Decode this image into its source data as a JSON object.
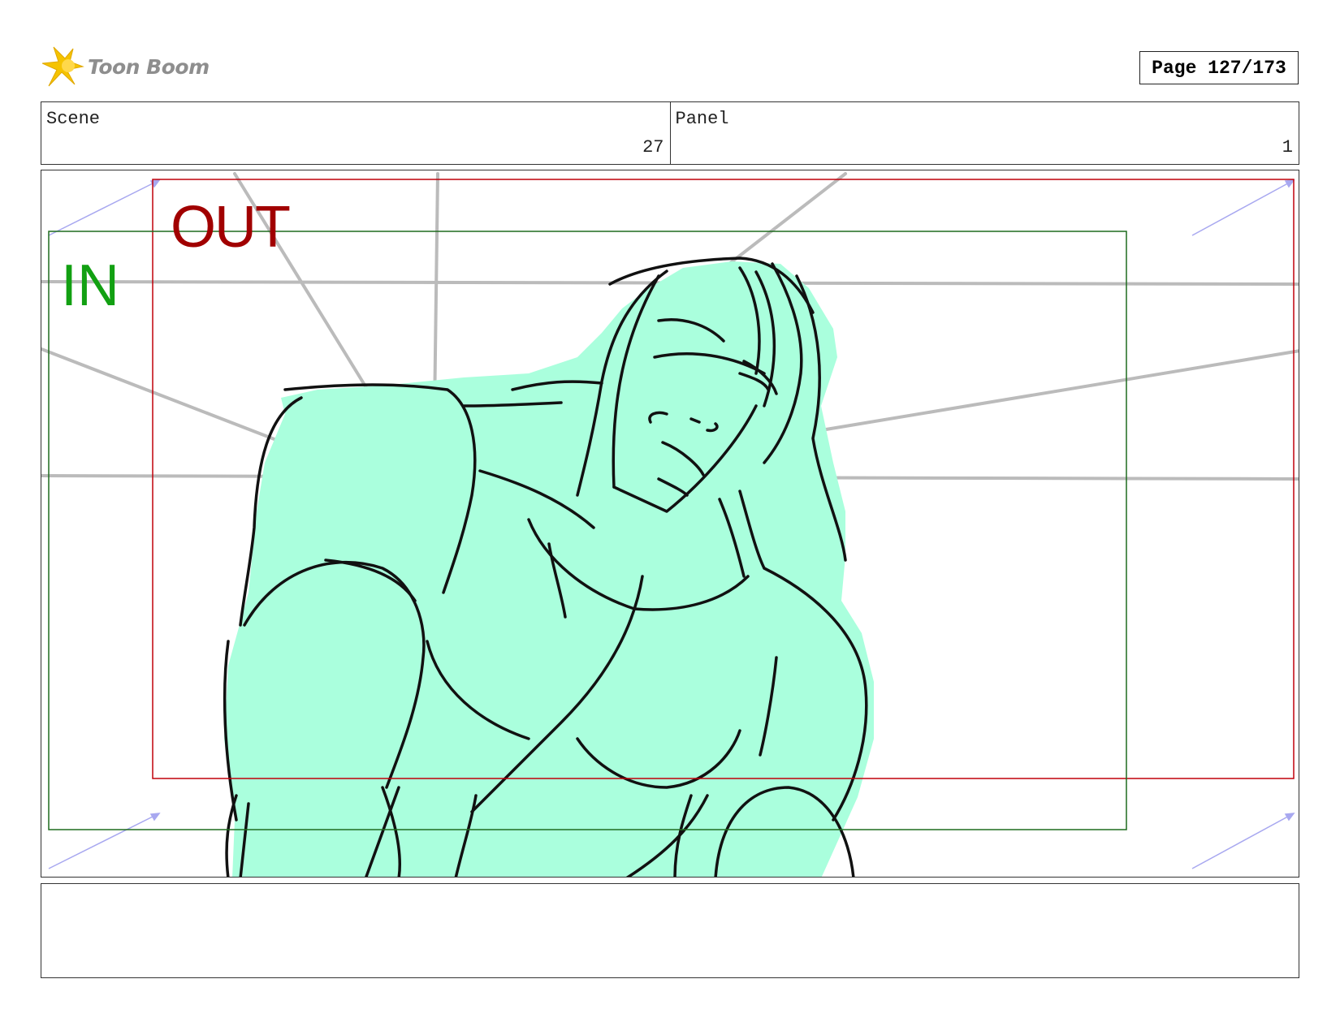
{
  "header": {
    "logo_text": "Toon Boom",
    "page_label": "Page 127/173"
  },
  "info": {
    "scene_label": "Scene",
    "scene_value": "27",
    "panel_label": "Panel",
    "panel_value": "1"
  },
  "drawing": {
    "out_label": "OUT",
    "in_label": "IN",
    "colors": {
      "out_frame": "#c0000a",
      "in_frame": "#1e6b1e",
      "fill": "#aaffdd",
      "perspective_lines": "#bbbbbb",
      "camera_arrows": "#a8a8f0",
      "logo_star": "#f5c300"
    }
  },
  "notes": {
    "text": ""
  }
}
